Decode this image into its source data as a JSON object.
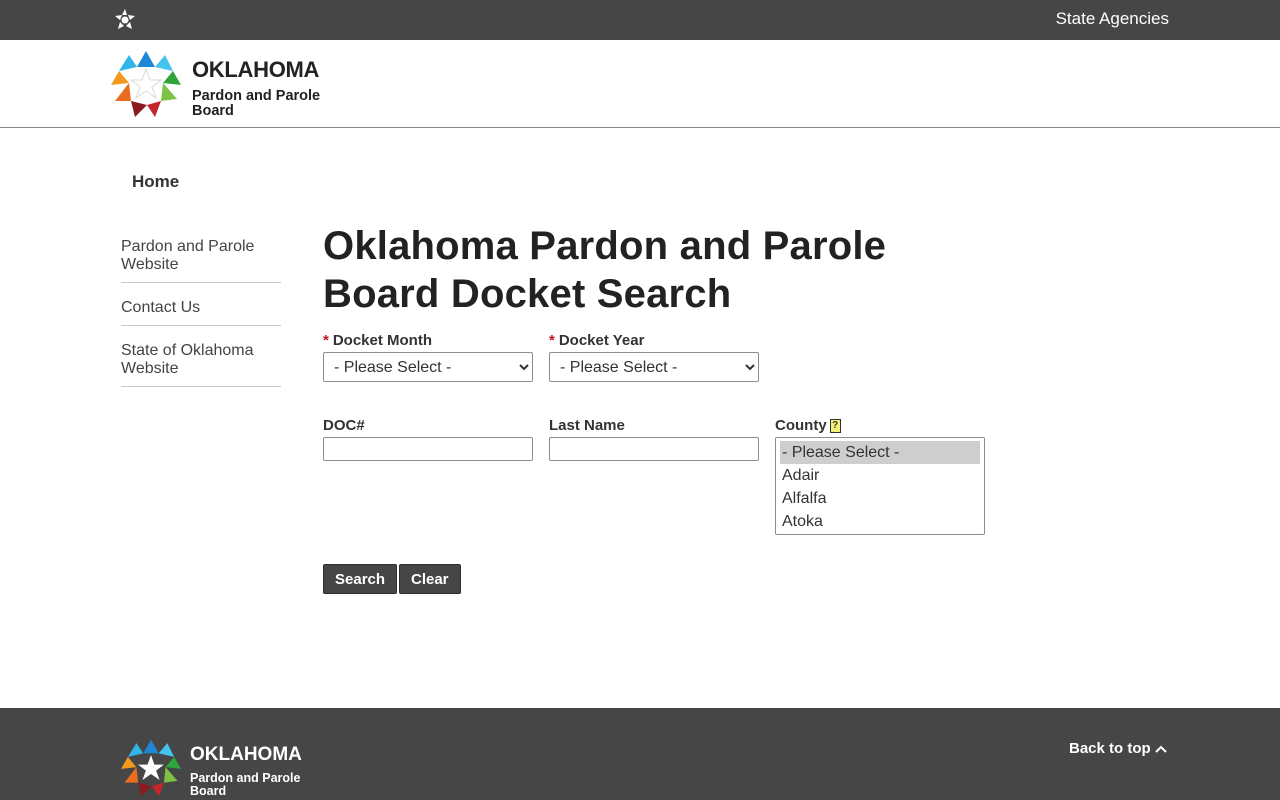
{
  "topbar": {
    "agencies_label": "State Agencies"
  },
  "logo": {
    "name": "OKLAHOMA",
    "subtitle": "Pardon and Parole Board"
  },
  "breadcrumb": {
    "home": "Home"
  },
  "sidebar": {
    "items": [
      {
        "label": "Pardon and Parole Website"
      },
      {
        "label": "Contact Us"
      },
      {
        "label": "State of Oklahoma Website"
      }
    ]
  },
  "page": {
    "title": "Oklahoma Pardon and Parole Board Docket Search"
  },
  "form": {
    "docket_month": {
      "required_mark": "*",
      "label": "Docket Month",
      "selected": "- Please Select -"
    },
    "docket_year": {
      "required_mark": "*",
      "label": "Docket Year",
      "selected": "- Please Select -"
    },
    "doc_number": {
      "label": "DOC#",
      "value": ""
    },
    "last_name": {
      "label": "Last Name",
      "value": ""
    },
    "county": {
      "label": "County",
      "help_glyph": "?",
      "options": [
        "- Please Select -",
        "Adair",
        "Alfalfa",
        "Atoka"
      ]
    },
    "search_label": "Search",
    "clear_label": "Clear"
  },
  "footer": {
    "name": "OKLAHOMA",
    "subtitle": "Pardon and Parole Board",
    "back_to_top": "Back to top"
  },
  "colors": {
    "bar": "#464646",
    "required": "#c0171d",
    "help_bg": "#f3f07a"
  }
}
